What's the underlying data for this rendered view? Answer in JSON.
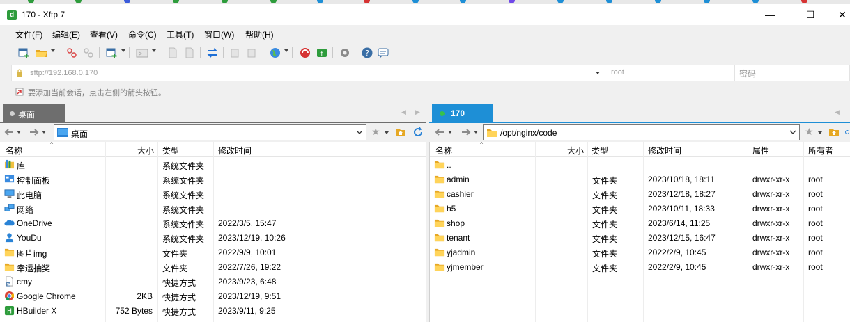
{
  "window": {
    "title": "170 - Xftp 7",
    "minimize": "—",
    "maximize": "☐",
    "close": "✕"
  },
  "menu": [
    "文件(F)",
    "编辑(E)",
    "查看(V)",
    "命令(C)",
    "工具(T)",
    "窗口(W)",
    "帮助(H)"
  ],
  "address": {
    "placeholder": "sftp://192.168.0.170",
    "user_placeholder": "root",
    "password_placeholder": "密码"
  },
  "hint": "要添加当前会话，点击左侧的箭头按钮。",
  "left": {
    "tab": "桌面",
    "path": "桌面",
    "columns": [
      "名称",
      "大小",
      "类型",
      "修改时间"
    ],
    "rows": [
      {
        "name": "库",
        "size": "",
        "type": "系统文件夹",
        "modified": "",
        "icon": "library-icon"
      },
      {
        "name": "控制面板",
        "size": "",
        "type": "系统文件夹",
        "modified": "",
        "icon": "control-panel-icon"
      },
      {
        "name": "此电脑",
        "size": "",
        "type": "系统文件夹",
        "modified": "",
        "icon": "computer-icon"
      },
      {
        "name": "网络",
        "size": "",
        "type": "系统文件夹",
        "modified": "",
        "icon": "network-icon"
      },
      {
        "name": "OneDrive",
        "size": "",
        "type": "系统文件夹",
        "modified": "2022/3/5, 15:47",
        "icon": "cloud-icon"
      },
      {
        "name": "YouDu",
        "size": "",
        "type": "系统文件夹",
        "modified": "2023/12/19, 10:26",
        "icon": "user-icon"
      },
      {
        "name": "图片img",
        "size": "",
        "type": "文件夹",
        "modified": "2022/9/9, 10:01",
        "icon": "folder-icon"
      },
      {
        "name": "幸运抽奖",
        "size": "",
        "type": "文件夹",
        "modified": "2022/7/26, 19:22",
        "icon": "folder-icon"
      },
      {
        "name": "cmy",
        "size": "",
        "type": "快捷方式",
        "modified": "2023/9/23, 6:48",
        "icon": "shortcut-icon"
      },
      {
        "name": "Google Chrome",
        "size": "2KB",
        "type": "快捷方式",
        "modified": "2023/12/19, 9:51",
        "icon": "chrome-icon"
      },
      {
        "name": "HBuilder X",
        "size": "752 Bytes",
        "type": "快捷方式",
        "modified": "2023/9/11, 9:25",
        "icon": "hbuilder-icon"
      }
    ]
  },
  "right": {
    "tab": "170",
    "path": "/opt/nginx/code",
    "columns": [
      "名称",
      "大小",
      "类型",
      "修改时间",
      "属性",
      "所有者"
    ],
    "rows": [
      {
        "name": "..",
        "size": "",
        "type": "",
        "modified": "",
        "attr": "",
        "owner": ""
      },
      {
        "name": "admin",
        "size": "",
        "type": "文件夹",
        "modified": "2023/10/18, 18:11",
        "attr": "drwxr-xr-x",
        "owner": "root"
      },
      {
        "name": "cashier",
        "size": "",
        "type": "文件夹",
        "modified": "2023/12/18, 18:27",
        "attr": "drwxr-xr-x",
        "owner": "root"
      },
      {
        "name": "h5",
        "size": "",
        "type": "文件夹",
        "modified": "2023/10/11, 18:33",
        "attr": "drwxr-xr-x",
        "owner": "root"
      },
      {
        "name": "shop",
        "size": "",
        "type": "文件夹",
        "modified": "2023/6/14, 11:25",
        "attr": "drwxr-xr-x",
        "owner": "root"
      },
      {
        "name": "tenant",
        "size": "",
        "type": "文件夹",
        "modified": "2023/12/15, 16:47",
        "attr": "drwxr-xr-x",
        "owner": "root"
      },
      {
        "name": "yjadmin",
        "size": "",
        "type": "文件夹",
        "modified": "2022/2/9, 10:45",
        "attr": "drwxr-xr-x",
        "owner": "root"
      },
      {
        "name": "yjmember",
        "size": "",
        "type": "文件夹",
        "modified": "2022/2/9, 10:45",
        "attr": "drwxr-xr-x",
        "owner": "root"
      }
    ]
  },
  "colors": {
    "active_tab": "#1e8fd6",
    "inactive_tab": "#6e6e6e",
    "folder": "#ffd45a",
    "connected_dot": "#36c24b"
  }
}
